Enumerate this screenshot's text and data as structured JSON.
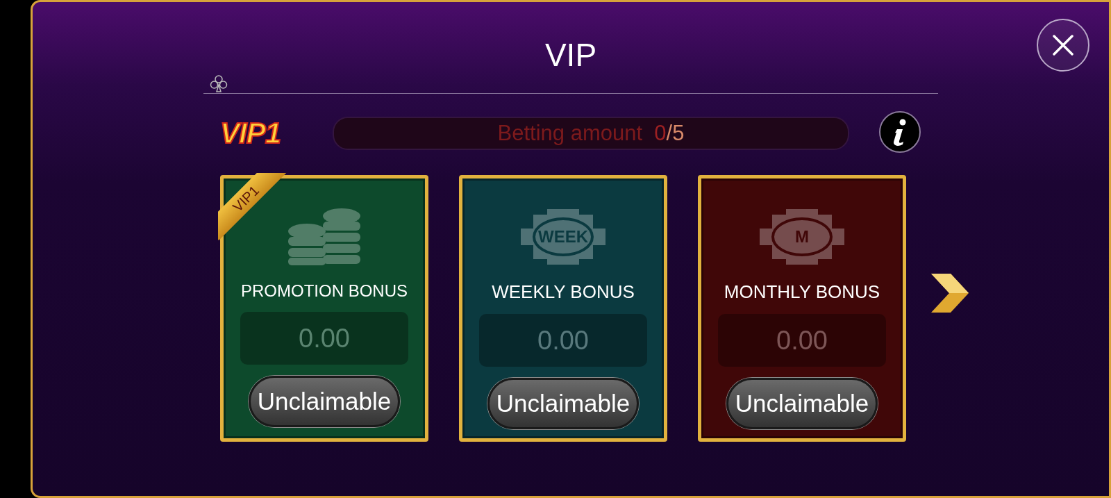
{
  "window": {
    "title": "VIP"
  },
  "level_badge": "VIP1",
  "progress": {
    "label": "Betting amount",
    "current": "0",
    "total": "/5",
    "level": 0
  },
  "cards": [
    {
      "kind": "coins",
      "color": "#0d4a2c",
      "ribbon": "VIP1",
      "title": "PROMOTION BONUS",
      "amount": "0.00",
      "button": "Unclaimable"
    },
    {
      "kind": "chip",
      "color": "#0b3a40",
      "icon_text": "WEEK",
      "title": "WEEKLY BONUS",
      "amount": "0.00",
      "button": "Unclaimable"
    },
    {
      "kind": "chip",
      "color": "#400708",
      "icon_text": "M",
      "title": "MONTHLY BONUS",
      "amount": "0.00",
      "button": "Unclaimable"
    }
  ]
}
